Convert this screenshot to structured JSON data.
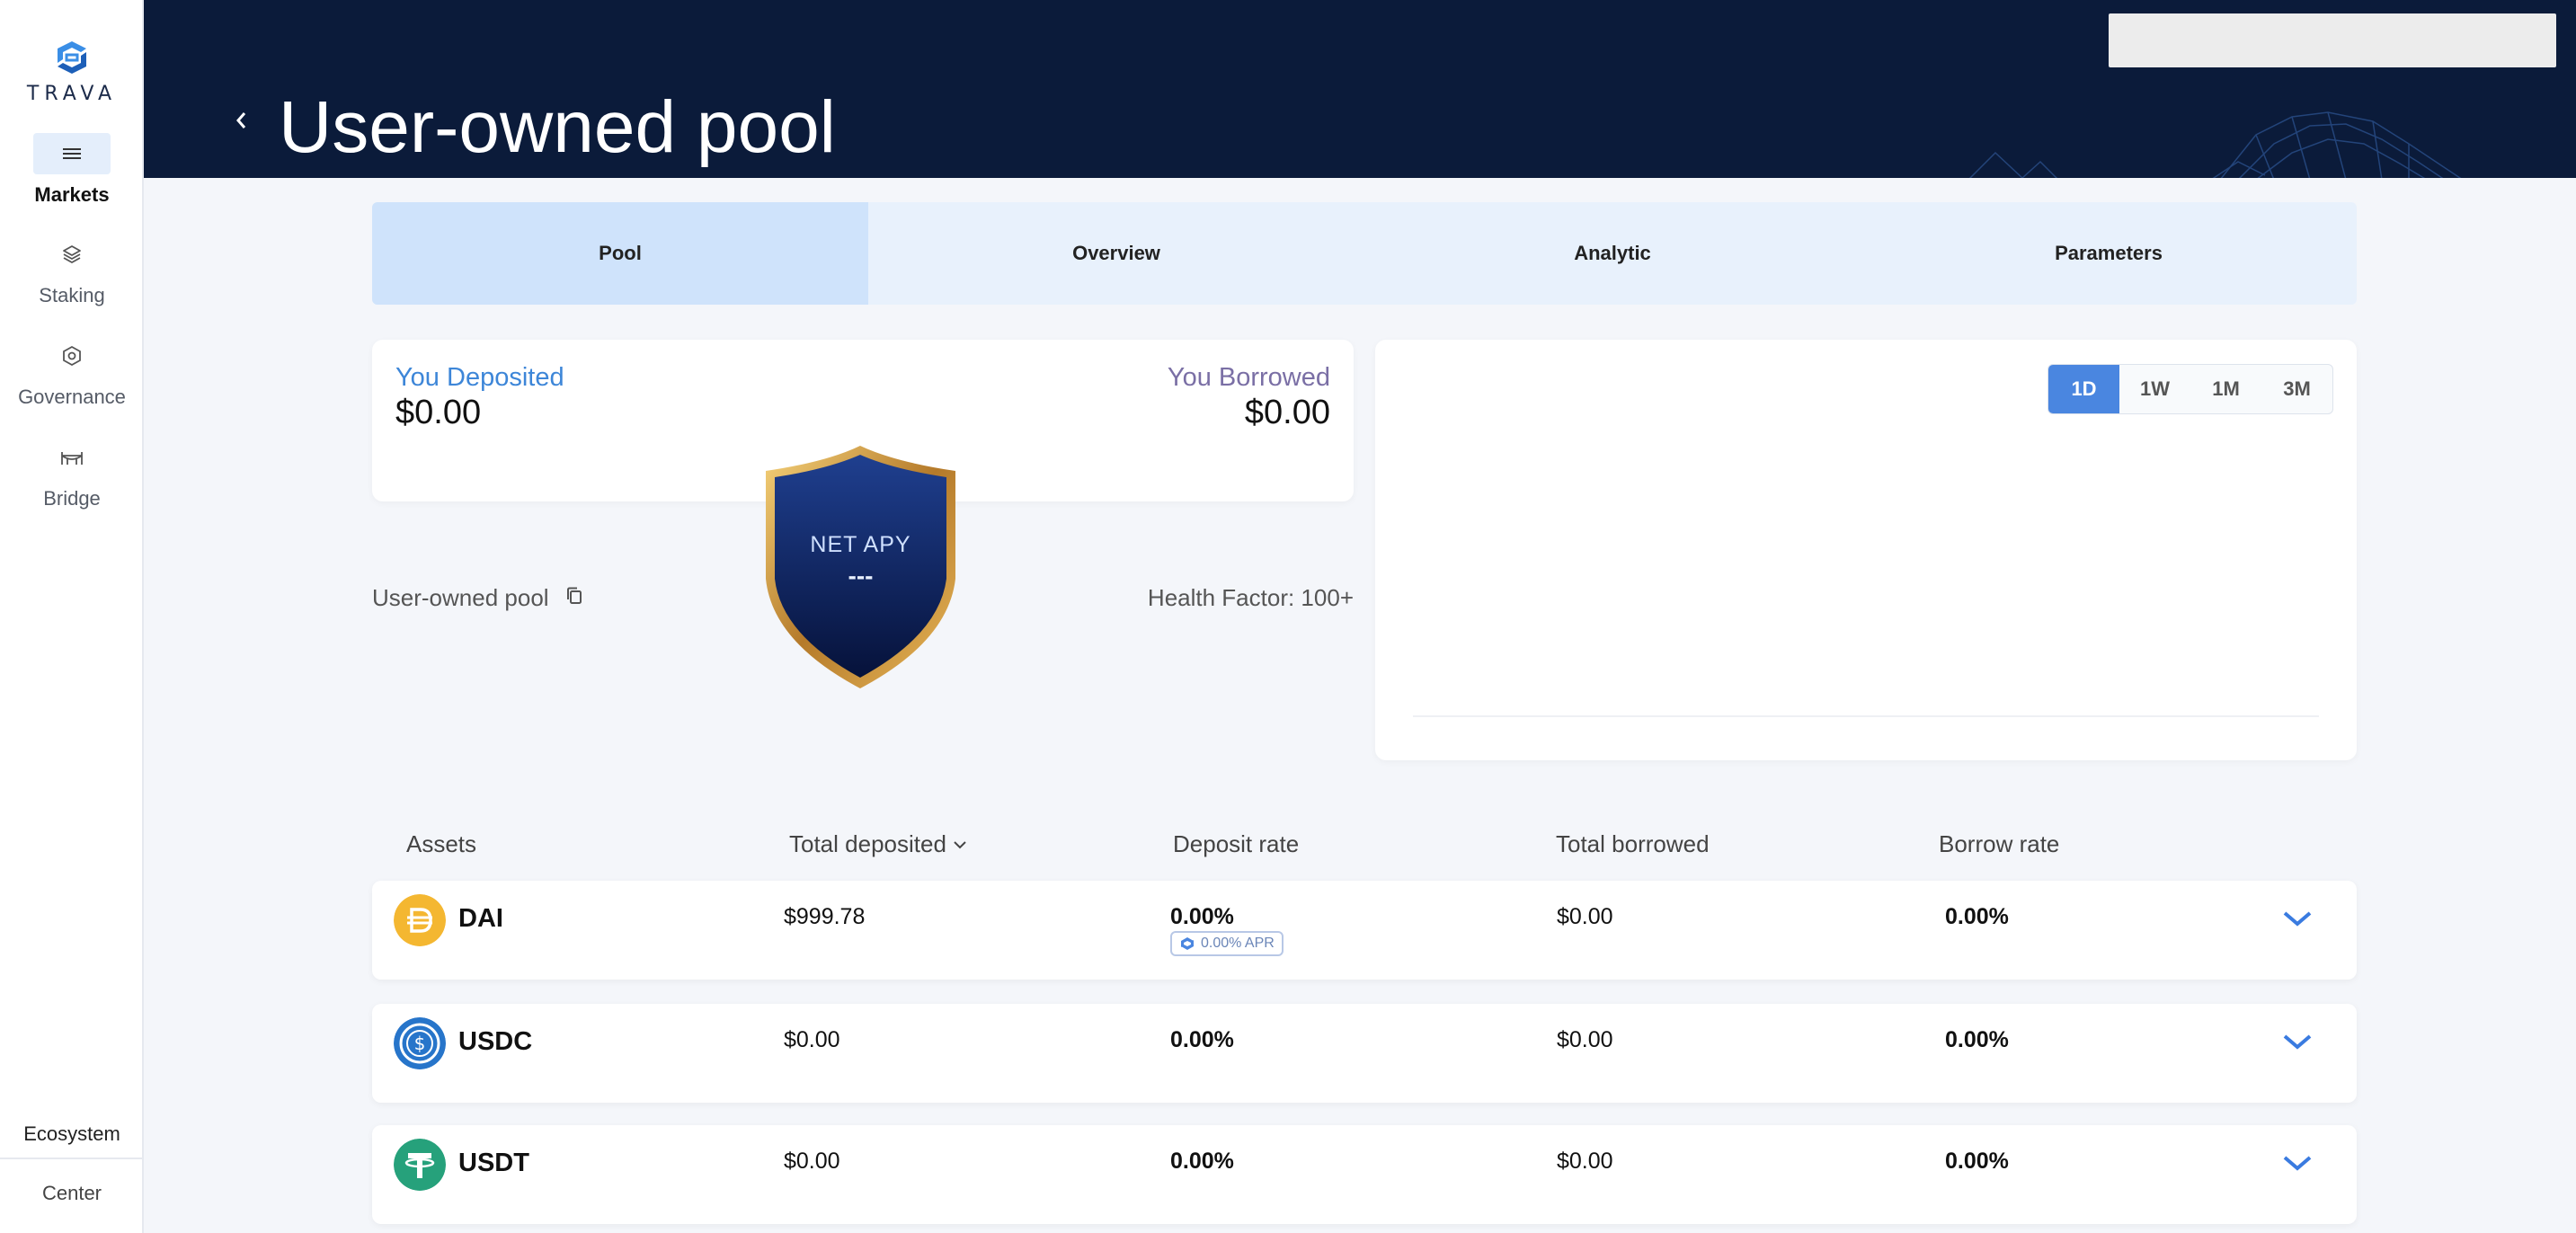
{
  "sidebar": {
    "logo_text": "TRAVA",
    "items": [
      {
        "label": "Markets",
        "icon": "menu-icon",
        "active": true
      },
      {
        "label": "Staking",
        "icon": "layers-icon",
        "active": false
      },
      {
        "label": "Governance",
        "icon": "hexagon-icon",
        "active": false
      },
      {
        "label": "Bridge",
        "icon": "bridge-icon",
        "active": false
      }
    ],
    "ecosystem_label": "Ecosystem",
    "center_label": "Center"
  },
  "header": {
    "title": "User-owned pool"
  },
  "tabs": [
    {
      "label": "Pool",
      "active": true
    },
    {
      "label": "Overview",
      "active": false
    },
    {
      "label": "Analytic",
      "active": false
    },
    {
      "label": "Parameters",
      "active": false
    }
  ],
  "summary": {
    "deposited_label": "You Deposited",
    "deposited_value": "$0.00",
    "borrowed_label": "You Borrowed",
    "borrowed_value": "$0.00",
    "pool_name": "User-owned pool",
    "health_factor": "Health Factor: 100+",
    "net_apy_label": "NET APY",
    "net_apy_value": "---"
  },
  "chart": {
    "periods": [
      {
        "label": "1D",
        "active": true
      },
      {
        "label": "1W",
        "active": false
      },
      {
        "label": "1M",
        "active": false
      },
      {
        "label": "3M",
        "active": false
      }
    ]
  },
  "table": {
    "headers": {
      "assets": "Assets",
      "total_deposited": "Total deposited",
      "deposit_rate": "Deposit rate",
      "total_borrowed": "Total borrowed",
      "borrow_rate": "Borrow rate"
    },
    "rows": [
      {
        "symbol": "DAI",
        "total_deposited": "$999.78",
        "deposit_rate": "0.00%",
        "apr_badge": "0.00% APR",
        "total_borrowed": "$0.00",
        "borrow_rate": "0.00%",
        "color": "#f4b731"
      },
      {
        "symbol": "USDC",
        "total_deposited": "$0.00",
        "deposit_rate": "0.00%",
        "apr_badge": "",
        "total_borrowed": "$0.00",
        "borrow_rate": "0.00%",
        "color": "#2775ca"
      },
      {
        "symbol": "USDT",
        "total_deposited": "$0.00",
        "deposit_rate": "0.00%",
        "apr_badge": "",
        "total_borrowed": "$0.00",
        "borrow_rate": "0.00%",
        "color": "#26a17b"
      }
    ]
  },
  "colors": {
    "header_bg": "#0b1b3a",
    "accent": "#4a86e0",
    "deposit_label": "#3d86d8",
    "borrow_label": "#7a6fa5",
    "chevron": "#3a7be0"
  }
}
